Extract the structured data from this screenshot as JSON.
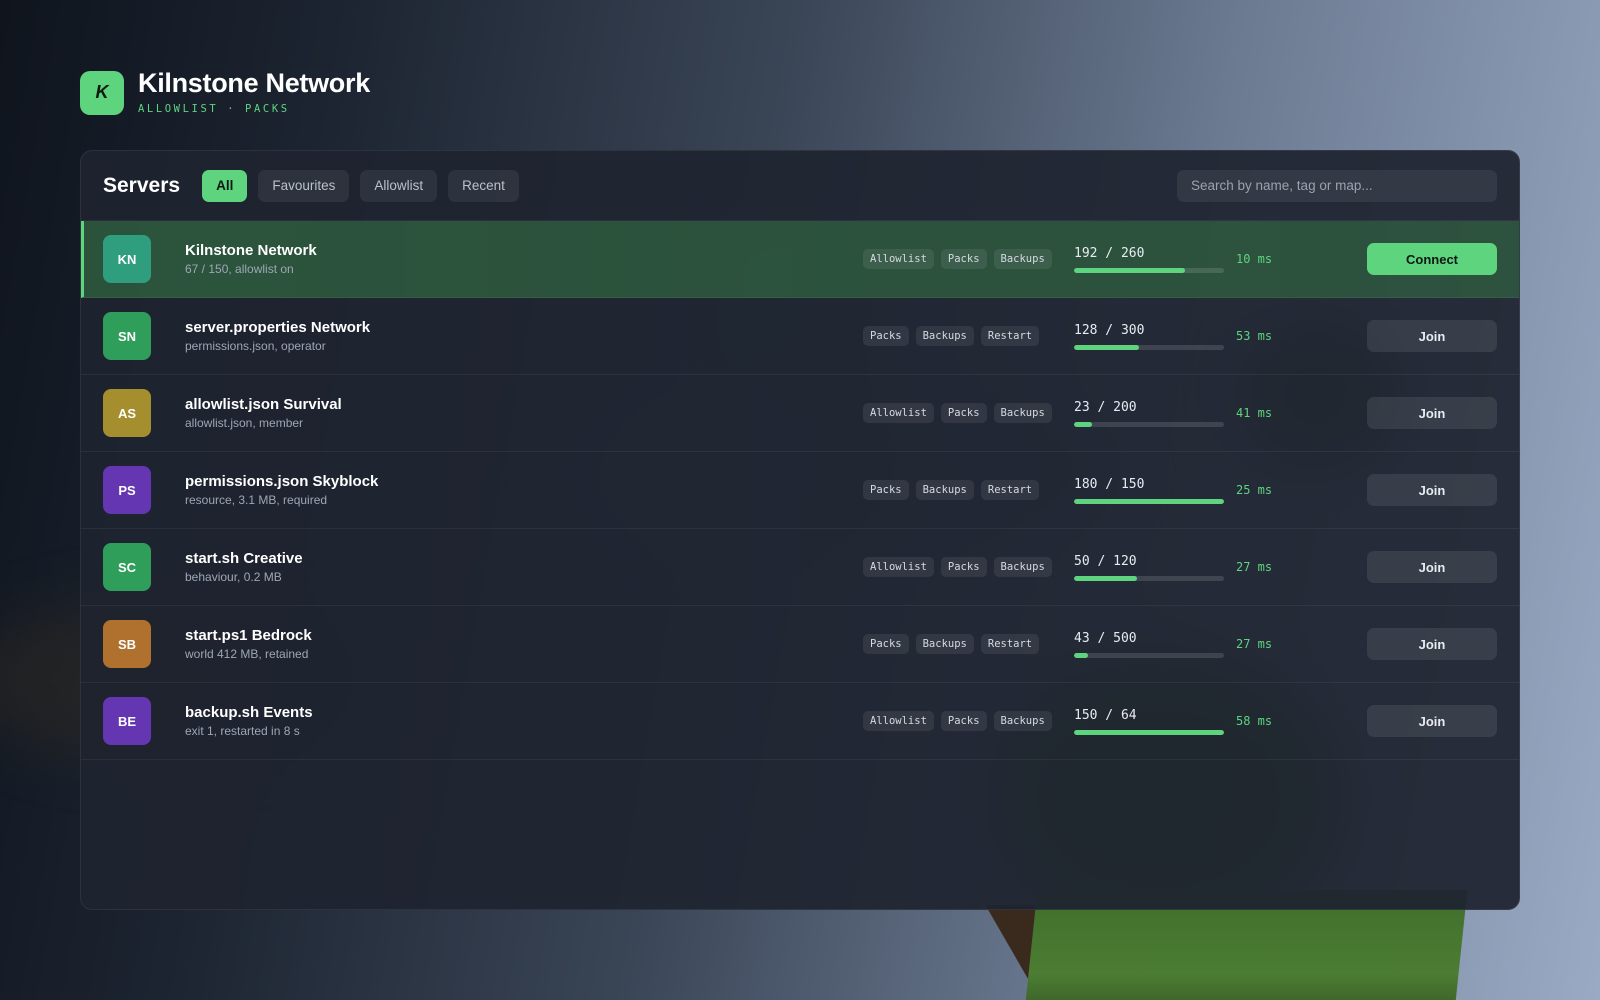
{
  "brand": {
    "logo_letter": "K",
    "title": "Kilnstone Network",
    "subtitle": "ALLOWLIST · PACKS",
    "accent": "#5ed47f"
  },
  "panel": {
    "title": "Servers",
    "tabs": [
      {
        "label": "All",
        "active": true
      },
      {
        "label": "Favourites",
        "active": false
      },
      {
        "label": "Allowlist",
        "active": false
      },
      {
        "label": "Recent",
        "active": false
      }
    ],
    "search_placeholder": "Search by name, tag or map..."
  },
  "servers": [
    {
      "initials": "KN",
      "color": "#2f9e7f",
      "name": "Kilnstone Network",
      "sub": "67 / 150, allowlist on",
      "tags": [
        "Allowlist",
        "Packs",
        "Backups"
      ],
      "players": "192 / 260",
      "fill": 0.74,
      "ping": "10 ms",
      "action": "Connect",
      "featured": true
    },
    {
      "initials": "SN",
      "color": "#2e9e5a",
      "name": "server.properties Network",
      "sub": "permissions.json, operator",
      "tags": [
        "Packs",
        "Backups",
        "Restart"
      ],
      "players": "128 / 300",
      "fill": 0.43,
      "ping": "53 ms",
      "action": "Join",
      "featured": false
    },
    {
      "initials": "AS",
      "color": "#a58e2e",
      "name": "allowlist.json Survival",
      "sub": "allowlist.json, member",
      "tags": [
        "Allowlist",
        "Packs",
        "Backups"
      ],
      "players": "23 / 200",
      "fill": 0.12,
      "ping": "41 ms",
      "action": "Join",
      "featured": false
    },
    {
      "initials": "PS",
      "color": "#6436b2",
      "name": "permissions.json Skyblock",
      "sub": "resource, 3.1 MB, required",
      "tags": [
        "Packs",
        "Backups",
        "Restart"
      ],
      "players": "180 / 150",
      "fill": 1.0,
      "ping": "25 ms",
      "action": "Join",
      "featured": false
    },
    {
      "initials": "SC",
      "color": "#2e9e5a",
      "name": "start.sh Creative",
      "sub": "behaviour, 0.2 MB",
      "tags": [
        "Allowlist",
        "Packs",
        "Backups"
      ],
      "players": "50 / 120",
      "fill": 0.42,
      "ping": "27 ms",
      "action": "Join",
      "featured": false
    },
    {
      "initials": "SB",
      "color": "#b0702e",
      "name": "start.ps1 Bedrock",
      "sub": "world 412 MB, retained",
      "tags": [
        "Packs",
        "Backups",
        "Restart"
      ],
      "players": "43 / 500",
      "fill": 0.09,
      "ping": "27 ms",
      "action": "Join",
      "featured": false
    },
    {
      "initials": "BE",
      "color": "#6436b2",
      "name": "backup.sh Events",
      "sub": "exit 1, restarted in 8 s",
      "tags": [
        "Allowlist",
        "Packs",
        "Backups"
      ],
      "players": "150 / 64",
      "fill": 1.0,
      "ping": "58 ms",
      "action": "Join",
      "featured": false
    }
  ]
}
